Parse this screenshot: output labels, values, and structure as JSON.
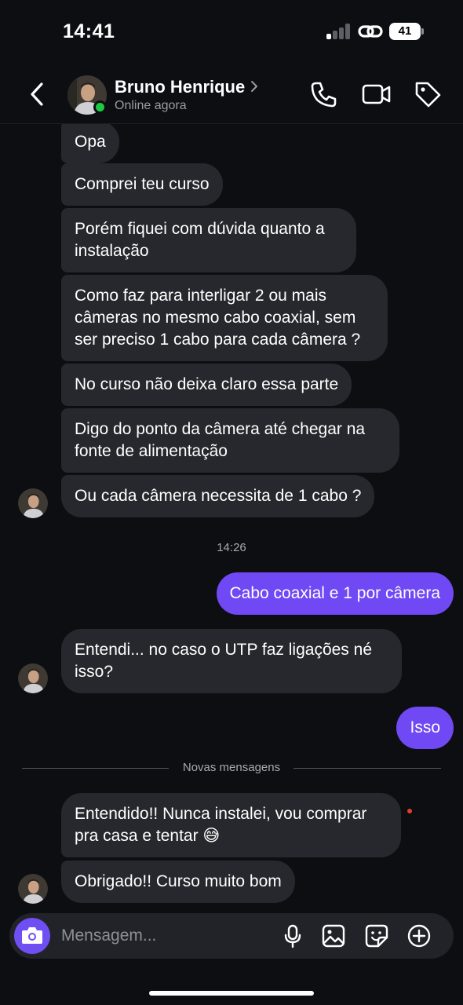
{
  "status_bar": {
    "time": "14:41",
    "battery": "41",
    "signal_bars_on": 1,
    "signal_bars_total": 4
  },
  "header": {
    "name": "Bruno Henrique",
    "status": "Online agora",
    "online_color": "#1cc941",
    "icons": [
      "chevron-left-icon",
      "chevron-right-icon",
      "phone-icon",
      "video-camera-icon",
      "tag-icon"
    ]
  },
  "messages": [
    {
      "text": "Opa",
      "direction": "incoming"
    },
    {
      "text": "Comprei teu curso",
      "direction": "incoming"
    },
    {
      "text": "Porém fiquei com dúvida quanto a instalação",
      "direction": "incoming"
    },
    {
      "text": "Como faz para interligar 2 ou mais câmeras no mesmo cabo coaxial, sem ser preciso 1 cabo para cada câmera ?",
      "direction": "incoming"
    },
    {
      "text": "No curso não deixa claro essa parte",
      "direction": "incoming"
    },
    {
      "text": "Digo do ponto da câmera até chegar na fonte de alimentação",
      "direction": "incoming"
    },
    {
      "text": "Ou cada câmera necessita de 1 cabo ?",
      "direction": "incoming"
    },
    {
      "text": "Cabo coaxial e 1 por câmera",
      "direction": "outgoing"
    },
    {
      "text": "Entendi... no caso o UTP faz ligações né isso?",
      "direction": "incoming"
    },
    {
      "text": "Isso",
      "direction": "outgoing"
    },
    {
      "text": "Entendido!! Nunca instalei, vou comprar pra casa e tentar 😅",
      "direction": "incoming"
    },
    {
      "text": "Obrigado!! Curso muito bom",
      "direction": "incoming"
    }
  ],
  "timestamp": "14:26",
  "new_messages_label": "Novas mensagens",
  "composer": {
    "placeholder": "Mensagem...",
    "icons": [
      "camera-icon",
      "microphone-icon",
      "image-icon",
      "sticker-icon",
      "plus-circle-icon"
    ]
  },
  "colors": {
    "background": "#0c0e12",
    "incoming_bubble": "#26282d",
    "outgoing_bubble": "#7049f4",
    "accent": "#6f4ff2",
    "unread_dot": "#e0412d"
  }
}
